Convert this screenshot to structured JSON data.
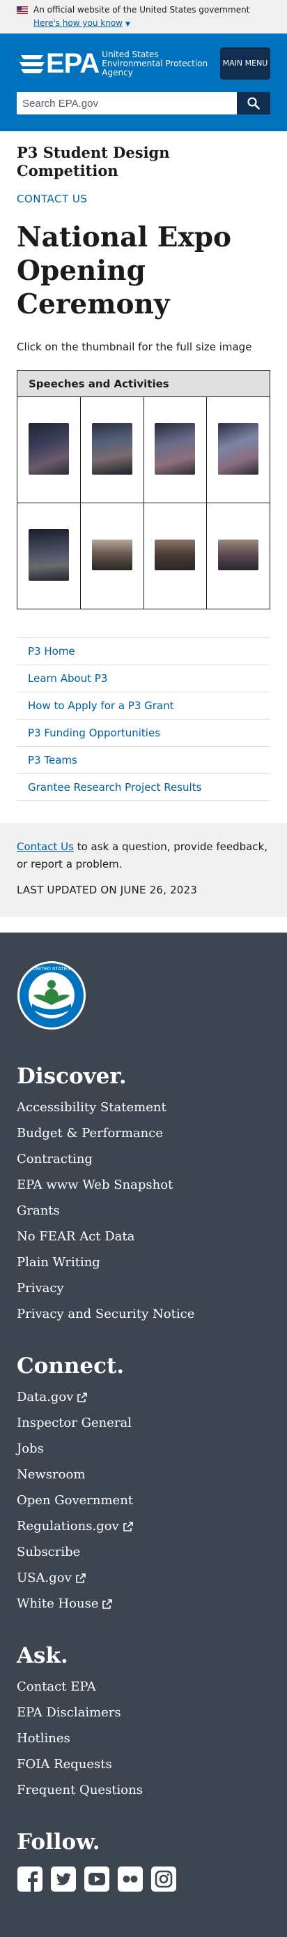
{
  "gov_banner": {
    "text": "An official website of the United States government",
    "link": "Here's how you know"
  },
  "header": {
    "logo_text": "EPA",
    "agency_name": "United States Environmental Protection Agency",
    "menu_label": "MAIN MENU",
    "search_placeholder": "Search EPA.gov"
  },
  "main": {
    "section_title": "P3 Student Design Competition",
    "contact_link": "CONTACT US",
    "page_title": "National Expo Opening Ceremony",
    "intro": "Click on the thumbnail for the full size image",
    "gallery": {
      "header": "Speeches and Activities",
      "rows": [
        [
          "photo-1",
          "photo-2",
          "photo-3",
          "photo-4"
        ],
        [
          "photo-5",
          "photo-6",
          "photo-7",
          "photo-8"
        ]
      ]
    },
    "side_nav": [
      "P3 Home",
      "Learn About P3",
      "How to Apply for a P3 Grant",
      "P3 Funding Opportunities",
      "P3 Teams",
      "Grantee Research Project Results"
    ]
  },
  "feedback": {
    "link": "Contact Us",
    "text": " to ask a question, provide feedback, or report a problem.",
    "last_updated": "LAST UPDATED ON JUNE 26, 2023"
  },
  "footer": {
    "sections": [
      {
        "heading": "Discover.",
        "items": [
          {
            "label": "Accessibility Statement"
          },
          {
            "label": "Budget & Performance"
          },
          {
            "label": "Contracting"
          },
          {
            "label": "EPA www Web Snapshot"
          },
          {
            "label": "Grants"
          },
          {
            "label": "No FEAR Act Data"
          },
          {
            "label": "Plain Writing"
          },
          {
            "label": "Privacy"
          },
          {
            "label": "Privacy and Security Notice"
          }
        ]
      },
      {
        "heading": "Connect.",
        "items": [
          {
            "label": "Data.gov",
            "external": true
          },
          {
            "label": "Inspector General"
          },
          {
            "label": "Jobs"
          },
          {
            "label": "Newsroom"
          },
          {
            "label": "Open Government"
          },
          {
            "label": "Regulations.gov",
            "external": true
          },
          {
            "label": "Subscribe"
          },
          {
            "label": "USA.gov",
            "external": true
          },
          {
            "label": "White House",
            "external": true
          }
        ]
      },
      {
        "heading": "Ask.",
        "items": [
          {
            "label": "Contact EPA"
          },
          {
            "label": "EPA Disclaimers"
          },
          {
            "label": "Hotlines"
          },
          {
            "label": "FOIA Requests"
          },
          {
            "label": "Frequent Questions"
          }
        ]
      }
    ],
    "follow_heading": "Follow.",
    "social": [
      "facebook-icon",
      "twitter-icon",
      "youtube-icon",
      "flickr-icon",
      "instagram-icon"
    ]
  },
  "colors": {
    "header_blue": "#0071bc",
    "navy": "#112e51",
    "link_blue": "#005ea2",
    "footer_gray": "#3d4551"
  }
}
